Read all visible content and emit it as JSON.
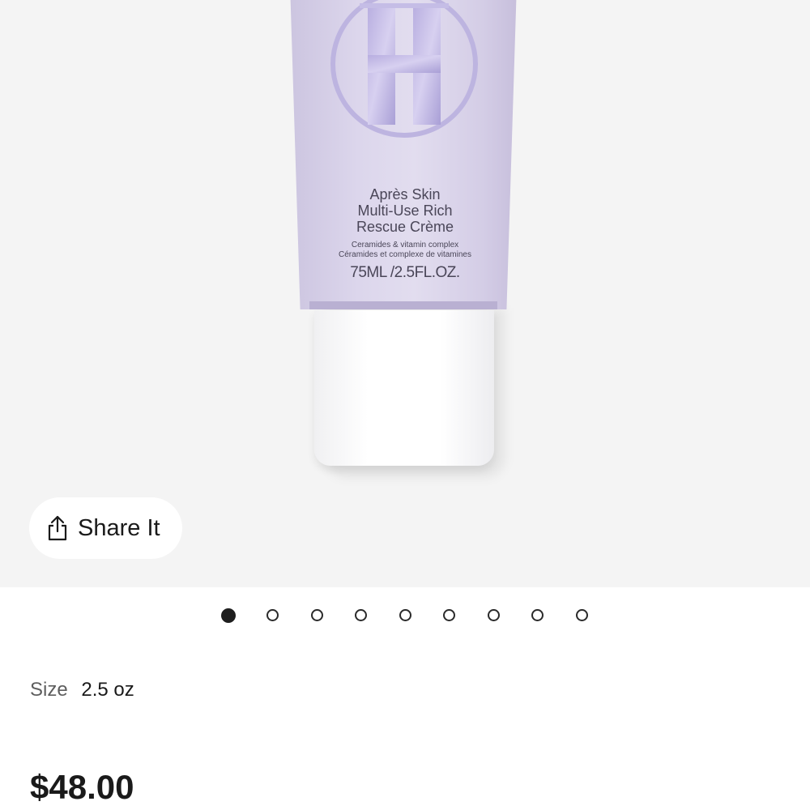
{
  "product": {
    "name_lines": [
      "Après Skin",
      "Multi-Use Rich",
      "Rescue Crème"
    ],
    "sub_lines": [
      "Ceramides & vitamin complex",
      "Céramides et complexe de vitamines"
    ],
    "volume": "75ML /2.5FL.OZ.",
    "tube_color": "#d8d2ea",
    "logo_letter": "H"
  },
  "share": {
    "label": "Share It",
    "icon": "share-icon"
  },
  "carousel": {
    "total": 9,
    "active_index": 0
  },
  "size": {
    "label": "Size",
    "value": "2.5 oz"
  },
  "price": "$48.00"
}
